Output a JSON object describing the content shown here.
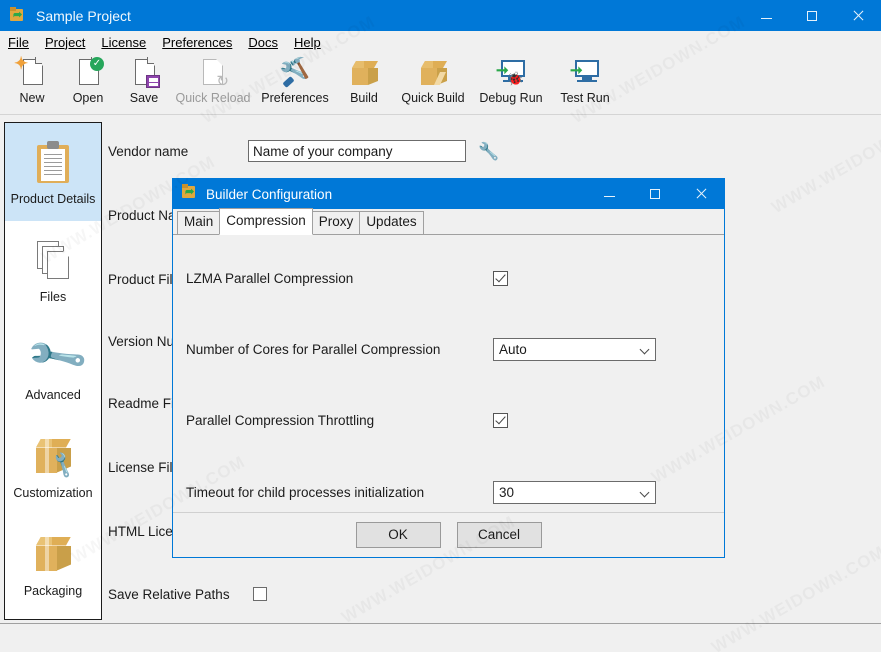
{
  "window": {
    "title": "Sample Project",
    "icon": "app-box-icon",
    "controls": {
      "minimize": "–",
      "maximize": "□",
      "close": "✕"
    }
  },
  "menubar": {
    "items": [
      {
        "label": "File",
        "mnemonic": "F"
      },
      {
        "label": "Project",
        "mnemonic": "P"
      },
      {
        "label": "License",
        "mnemonic": "L"
      },
      {
        "label": "Preferences",
        "mnemonic": "P"
      },
      {
        "label": "Docs",
        "mnemonic": "D"
      },
      {
        "label": "Help",
        "mnemonic": "H"
      }
    ]
  },
  "toolbar": {
    "buttons": [
      {
        "label": "New",
        "icon": "new-document-icon",
        "disabled": false
      },
      {
        "label": "Open",
        "icon": "open-document-icon",
        "disabled": false
      },
      {
        "label": "Save",
        "icon": "save-disk-icon",
        "disabled": false
      },
      {
        "label": "Quick Reload",
        "icon": "quick-reload-icon",
        "disabled": true
      },
      {
        "label": "Preferences",
        "icon": "preferences-tools-icon",
        "disabled": false
      },
      {
        "label": "Build",
        "icon": "build-box-icon",
        "disabled": false
      },
      {
        "label": "Quick Build",
        "icon": "quick-build-box-icon",
        "disabled": false
      },
      {
        "label": "Debug Run",
        "icon": "debug-run-monitor-icon",
        "disabled": false
      },
      {
        "label": "Test Run",
        "icon": "test-run-monitor-icon",
        "disabled": false
      }
    ]
  },
  "sidebar": {
    "items": [
      {
        "label": "Product Details",
        "icon": "clipboard-icon",
        "active": true
      },
      {
        "label": "Files",
        "icon": "files-stack-icon",
        "active": false
      },
      {
        "label": "Advanced",
        "icon": "wrench-icon",
        "active": false
      },
      {
        "label": "Customization",
        "icon": "box-wrench-icon",
        "active": false
      },
      {
        "label": "Packaging",
        "icon": "package-box-icon",
        "active": false
      }
    ]
  },
  "form": {
    "vendor_name": {
      "label": "Vendor name",
      "value": "Name of your company",
      "tool_icon": "wrench-icon"
    },
    "product_name": {
      "label": "Product Na"
    },
    "product_file": {
      "label": "Product Fil"
    },
    "version_number": {
      "label": "Version Nu"
    },
    "readme_file": {
      "label": "Readme Fi"
    },
    "license_file": {
      "label": "License File"
    },
    "html_license": {
      "label": "HTML Lice"
    },
    "save_relative_paths": {
      "label": "Save Relative Paths",
      "checked": false
    }
  },
  "dialog": {
    "title": "Builder Configuration",
    "icon": "app-box-icon",
    "controls": {
      "minimize": "–",
      "maximize": "□",
      "close": "✕"
    },
    "tabs": [
      {
        "label": "Main",
        "active": false
      },
      {
        "label": "Compression",
        "active": true
      },
      {
        "label": "Proxy",
        "active": false
      },
      {
        "label": "Updates",
        "active": false
      }
    ],
    "fields": [
      {
        "label": "LZMA Parallel Compression",
        "type": "checkbox",
        "checked": true
      },
      {
        "label": "Number of Cores for Parallel Compression",
        "type": "combobox",
        "value": "Auto"
      },
      {
        "label": "Parallel Compression Throttling",
        "type": "checkbox",
        "checked": true
      },
      {
        "label": "Timeout for child processes initialization",
        "type": "combobox",
        "value": "30"
      }
    ],
    "buttons": {
      "ok": "OK",
      "cancel": "Cancel"
    }
  },
  "watermark": {
    "text": "WWW.WEIDOWN.COM"
  },
  "colors": {
    "accent": "#0078d7",
    "window_bg": "#f0f0f0",
    "sidebar_active": "#cce4f7",
    "icon_gold": "#e0b15c",
    "icon_blue": "#2e6da4",
    "icon_green": "#2ba84a"
  }
}
